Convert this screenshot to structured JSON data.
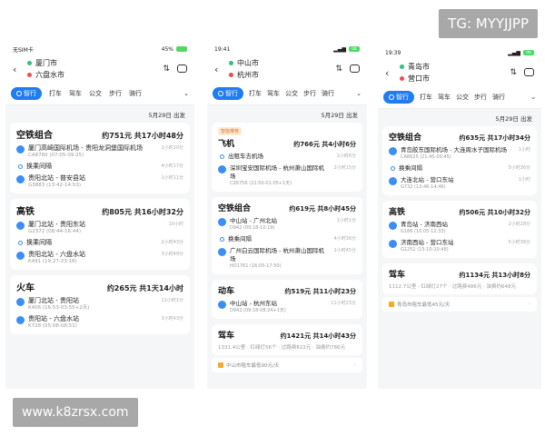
{
  "watermark_top": "TG: MYYJJPP",
  "watermark_bottom": "www.k8zrsx.com",
  "tabs": [
    "智行",
    "打车",
    "驾车",
    "公交",
    "步行",
    "骑行"
  ],
  "phone1": {
    "status_left": "无SIM卡",
    "status_right": "45%",
    "from": "厦门市",
    "to": "六盘水市",
    "date": "5月29日 出发",
    "cards": [
      {
        "title": "空铁组合",
        "meta": "约751元 共17小时48分",
        "segs": [
          {
            "main": "厦门高崎国际机场 - 贵阳龙洞堡国际机场",
            "sub": "CA8760 (07:05-09:25)",
            "right": "2小时20分"
          },
          {
            "main": "换乘间隔",
            "sub": "",
            "right": "4小时17分"
          },
          {
            "main": "贵阳北站 - 普安县站",
            "sub": "G3883 (13:42-14:53)",
            "right": "1小时11分"
          }
        ]
      },
      {
        "title": "高铁",
        "meta": "约805元 共16小时32分",
        "segs": [
          {
            "main": "厦门北站 - 贵阳东站",
            "sub": "G2372 (08:44-16:44)",
            "right": "10小时"
          },
          {
            "main": "换乘间隔",
            "sub": "",
            "right": "2小时43分"
          },
          {
            "main": "贵阳北站 - 六盘水站",
            "sub": "K491 (19:27-23:16)",
            "right": "3小时49分"
          }
        ]
      },
      {
        "title": "火车",
        "meta": "约265元 共1天14小时",
        "segs": [
          {
            "main": "厦门北站 - 贵阳站",
            "sub": "K406 (16:53-03:55+2天)",
            "right": "11小时1分"
          },
          {
            "main": "贵阳站 - 六盘水站",
            "sub": "K728 (05:08-08:51)",
            "right": "3小时43分"
          }
        ]
      }
    ]
  },
  "phone2": {
    "status_left": "19:41",
    "status_right": "OK",
    "from": "中山市",
    "to": "杭州市",
    "date": "5月29日 出发",
    "badge": "智能推荐",
    "cards": [
      {
        "title": "飞机",
        "meta": "约766元 共4小时6分",
        "segs": [
          {
            "main": "出租车去机场",
            "sub": "",
            "right": "1小时6分"
          },
          {
            "main": "深圳宝安国际机场 - 杭州萧山国际机场",
            "sub": "CZ6756 (22:50-01:05+1天)",
            "right": "2小时15分"
          }
        ]
      },
      {
        "title": "空铁组合",
        "meta": "约619元 共8小时45分",
        "segs": [
          {
            "main": "中山站 - 广州北站",
            "sub": "D942 (09:18-10:19)",
            "right": "1小时1分"
          },
          {
            "main": "换乘间隔",
            "sub": "",
            "right": "4小时36分"
          },
          {
            "main": "广州白云国际机场 - 杭州萧山国际机场",
            "sub": "HO1761 (16:05-17:50)",
            "right": "1小时45分"
          }
        ]
      },
      {
        "title": "动车",
        "meta": "约519元 共11小时23分",
        "segs": [
          {
            "main": "中山站 - 杭州东站",
            "sub": "D942 (09:18-08:24+1天)",
            "right": "11小时23分"
          }
        ]
      },
      {
        "title": "驾车",
        "meta": "约1421元 共14小时43分",
        "plain": "1331.4公里 · 红绿灯56个 · 过路费822元 · 油费约786元"
      }
    ],
    "taxi": "中山市租车最低90元/天"
  },
  "phone3": {
    "status_left": "19:39",
    "status_right": "OK",
    "from": "青岛市",
    "to": "营口市",
    "date": "5月29日 出发",
    "cards": [
      {
        "title": "空铁组合",
        "meta": "约635元 共17小时34分",
        "segs": [
          {
            "main": "青岛胶东国际机场 - 大连周水子国际机场",
            "sub": "CA8625 (21:45-00:45)",
            "right": "1小时"
          },
          {
            "main": "换乘间隔",
            "sub": "",
            "right": "5小时36分"
          },
          {
            "main": "大连北站 - 营口东站",
            "sub": "G732 (13:46-14:46)",
            "right": "1小时"
          }
        ]
      },
      {
        "title": "高铁",
        "meta": "约506元 共10小时32分",
        "segs": [
          {
            "main": "青岛站 - 济南西站",
            "sub": "G186 (10:05-12:33)",
            "right": "2小时28分"
          },
          {
            "main": "济南西站 - 营口东站",
            "sub": "G1252 (15:10-20:48)",
            "right": "5小时38分"
          }
        ]
      },
      {
        "title": "驾车",
        "meta": "约1134元 共13小时8分",
        "plain": "1112.7公里 · 红绿灯27个 · 过路费486元 · 油费约648元"
      }
    ],
    "taxi": "青岛市租车最低45元/天"
  }
}
